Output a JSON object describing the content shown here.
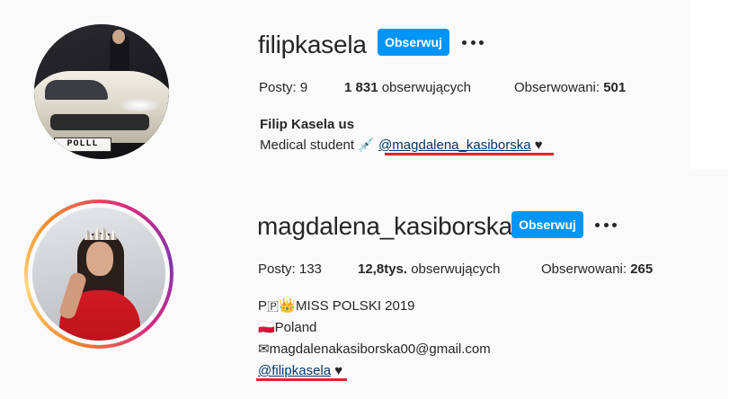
{
  "profile1": {
    "username": "filipkasela",
    "follow_label": "Obserwuj",
    "more_icon": "more-horizontal-icon",
    "posts_label": "Posty:",
    "posts_count": "9",
    "followers_count": "1 831",
    "followers_label": "obserwujących",
    "following_label": "Obserwowani:",
    "following_count": "501",
    "name": "Filip Kasela us",
    "bio_text": "Medical student 💉",
    "bio_mention": "@magdalena_kasiborska",
    "bio_heart": "♥",
    "avatar_plate": "POLLL"
  },
  "profile2": {
    "username": "magdalena_kasiborska",
    "follow_label": "Obserwuj",
    "more_icon": "more-horizontal-icon",
    "posts_label": "Posty:",
    "posts_count": "133",
    "followers_count": "12,8tys.",
    "followers_label": "obserwujących",
    "following_label": "Obserwowani:",
    "following_count": "265",
    "bio_line1": "P🇵👑MISS POLSKI 2019",
    "bio_line2": "🇵🇱Poland",
    "bio_line3": "✉magdalenakasiborska00@gmail.com",
    "bio_mention": "@filipkasela",
    "bio_heart": "♥"
  },
  "colors": {
    "follow_button": "#0095f6",
    "mention": "#00376b",
    "annotation_underline": "#e3212f",
    "background": "#fafafa"
  }
}
